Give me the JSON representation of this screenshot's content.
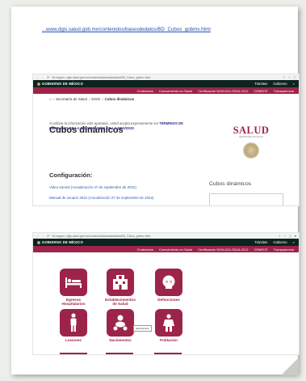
{
  "page_url": "...www.dgis.salud.gob.mx/contenidos/basesdedatos/BD_Cubos_gobmx.html",
  "colors": {
    "guinda": "#9d2449",
    "gov_dark": "#0c231e",
    "link": "#2a5db0"
  },
  "browser": {
    "address": "No seguro | dgis.salud.gob.mx/contenidos/basesdedatos/BD_Cubos_gobmx.html",
    "address2": "No seguro | dgis.salud.gob.mx/contenidos/basesdedatos/BD_Cubos_gobmx.html"
  },
  "gov_header": {
    "logo": "GOBIERNO DE MÉXICO",
    "links": [
      "Trámites",
      "Gobierno"
    ],
    "search_icon": "search-icon"
  },
  "sec_nav": {
    "items": [
      "Contenidos",
      "Conocimiento en Salud",
      "Certificación NOM-024-SSA3-2012",
      "CEMECE",
      "Transparencia"
    ]
  },
  "breadcrumb": {
    "sep": "›",
    "items": [
      "Secretaría de Salud",
      "DGIS",
      "Cubos dinámicos"
    ]
  },
  "main": {
    "title": "Cubos dinámicos",
    "intro": "Al utilizar la información este apartado, usted acepta expresamente los",
    "intro_terms": "TÉRMINOS DE LIBRE USO DE LA INFORMACIÓN DE LA SSA/DGIS",
    "config_title": "Configuración:",
    "links": [
      "Video tutorial (Actualización 27 de septiembre de 2022)",
      "Manual de usuario 2022 (Actualización 27 de septiembre de 2022)"
    ]
  },
  "sidebar": {
    "logo": "SALUD",
    "logo_sub": "SECRETARÍA DE SALUD",
    "heading": "Cubos dinámicos"
  },
  "tiles": [
    {
      "label": "Egresos Hospitalarios",
      "icon": "hospital-bed-icon"
    },
    {
      "label": "Establecimientos de Salud",
      "icon": "hospital-building-icon"
    },
    {
      "label": "Defunciones",
      "icon": "skull-icon"
    },
    {
      "label": "Lesiones",
      "icon": "injured-person-icon"
    },
    {
      "label": "Nacimientos",
      "icon": "baby-icon"
    },
    {
      "label": "Población",
      "icon": "population-icon"
    }
  ],
  "tooltip": "Nacimientos"
}
